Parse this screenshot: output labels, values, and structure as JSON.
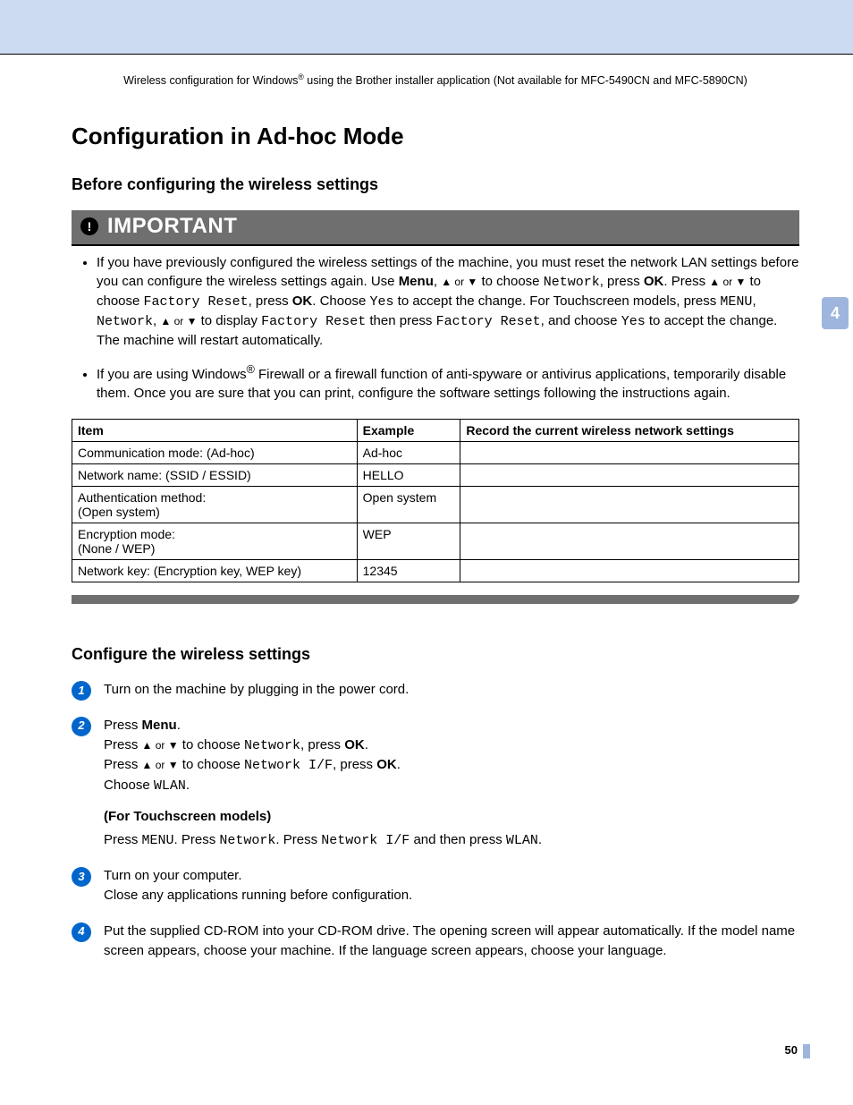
{
  "header": {
    "text_pre": "Wireless configuration for Windows",
    "reg": "®",
    "text_post": " using the Brother installer application (Not available for MFC-5490CN and MFC-5890CN)"
  },
  "side_tab": "4",
  "page_number": "50",
  "h1": "Configuration in Ad-hoc Mode",
  "h2a": "Before configuring the wireless settings",
  "important_label": "IMPORTANT",
  "bullets": {
    "b1": {
      "a": "If you have previously configured the wireless settings of the machine, you must reset the network LAN settings before you can configure the wireless settings again. Use ",
      "menu": "Menu",
      "b": ", ",
      "arrows1": "▲ or ▼",
      "c": " to choose ",
      "network": "Network",
      "d": ", press ",
      "ok1": "OK",
      "e": ". Press ",
      "arrows2": "▲ or ▼",
      "f": " to choose ",
      "factory_reset": "Factory Reset",
      "g": ", press ",
      "ok2": "OK",
      "h": ". Choose ",
      "yes1": "Yes",
      "i": " to accept the change. For Touchscreen models, press ",
      "menu2": "MENU",
      "j": ", ",
      "network2": "Network",
      "k": ", ",
      "arrows3": "▲ or ▼",
      "l": " to display ",
      "factory_reset2": "Factory Reset",
      "m": " then press ",
      "factory_reset3": "Factory Reset",
      "n": ", and choose ",
      "yes2": "Yes",
      "o": " to accept the change. The machine will restart automatically."
    },
    "b2": {
      "a": "If you are using Windows",
      "reg": "®",
      "b": " Firewall or a firewall function of anti-spyware or antivirus applications, temporarily disable them. Once you are sure that you can print, configure the software settings following the instructions again."
    }
  },
  "table": {
    "head": {
      "c1": "Item",
      "c2": "Example",
      "c3": "Record the current wireless network settings"
    },
    "rows": [
      {
        "c1": "Communication mode: (Ad-hoc)",
        "c2": "Ad-hoc",
        "c3": ""
      },
      {
        "c1": "Network name: (SSID / ESSID)",
        "c2": "HELLO",
        "c3": ""
      },
      {
        "c1a": "Authentication method:",
        "c1b": "(Open system)",
        "c2": "Open system",
        "c3": ""
      },
      {
        "c1a": "Encryption mode:",
        "c1b": "(None / WEP)",
        "c2": "WEP",
        "c3": ""
      },
      {
        "c1": "Network key: (Encryption key, WEP key)",
        "c2": "12345",
        "c3": ""
      }
    ]
  },
  "h2b": "Configure the wireless settings",
  "steps": {
    "s1": "Turn on the machine by plugging in the power cord.",
    "s2": {
      "a": "Press ",
      "menu": "Menu",
      "a2": ".",
      "b": "Press ",
      "arrows1": "▲ or ▼",
      "c": " to choose ",
      "network": "Network",
      "d": ", press ",
      "ok1": "OK",
      "d2": ".",
      "e": "Press ",
      "arrows2": "▲ or ▼",
      "f": " to choose ",
      "netif": "Network I/F",
      "g": ", press ",
      "ok2": "OK",
      "g2": ".",
      "h": "Choose ",
      "wlan": "WLAN",
      "h2": ".",
      "sub": "(For Touchscreen models)",
      "t_a": "Press ",
      "t_menu": "MENU",
      "t_b": ". Press ",
      "t_network": "Network",
      "t_c": ". Press ",
      "t_netif": "Network I/F",
      "t_d": " and then press ",
      "t_wlan": "WLAN",
      "t_e": "."
    },
    "s3": {
      "a": "Turn on your computer.",
      "b": "Close any applications running before configuration."
    },
    "s4": "Put the supplied CD-ROM into your CD-ROM drive. The opening screen will appear automatically. If the model name screen appears, choose your machine. If the language screen appears, choose your language."
  }
}
